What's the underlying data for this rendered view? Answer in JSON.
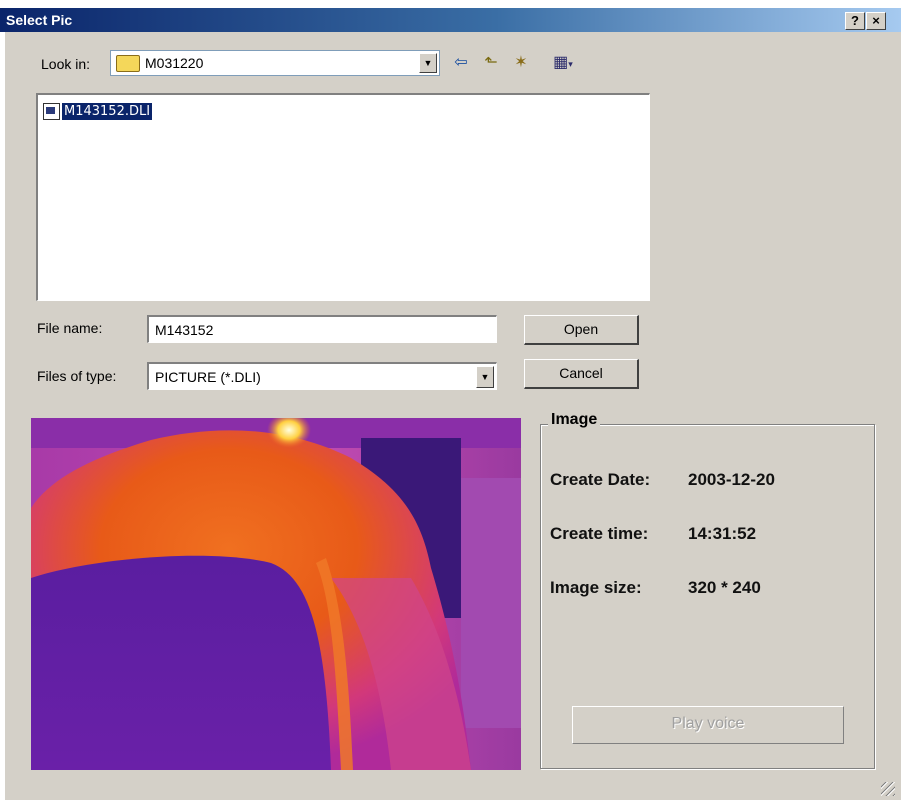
{
  "title": "Select Pic",
  "caption_buttons": {
    "help": "?",
    "close": "×"
  },
  "look_in": {
    "label": "Look in:",
    "value": "M031220"
  },
  "toolbar": {
    "back": "⇦",
    "up": "⬑",
    "new_folder": "✶",
    "view_menu": "▦"
  },
  "files": [
    {
      "name": "M143152.DLI",
      "selected": true
    }
  ],
  "file_name": {
    "label": "File name:",
    "value": "M143152"
  },
  "file_type": {
    "label": "Files of type:",
    "value": "PICTURE (*.DLI)"
  },
  "buttons": {
    "open": "Open",
    "cancel": "Cancel",
    "play_voice": "Play voice"
  },
  "image_group": {
    "title": "Image",
    "create_date_label": "Create Date:",
    "create_date": "2003-12-20",
    "create_time_label": "Create time:",
    "create_time": "14:31:52",
    "image_size_label": "Image size:",
    "image_size": "320 * 240"
  },
  "colors": {
    "titlebar_start": "#0a246a",
    "titlebar_end": "#a6caf0",
    "face": "#d4d0c8",
    "selection": "#0a246a"
  }
}
